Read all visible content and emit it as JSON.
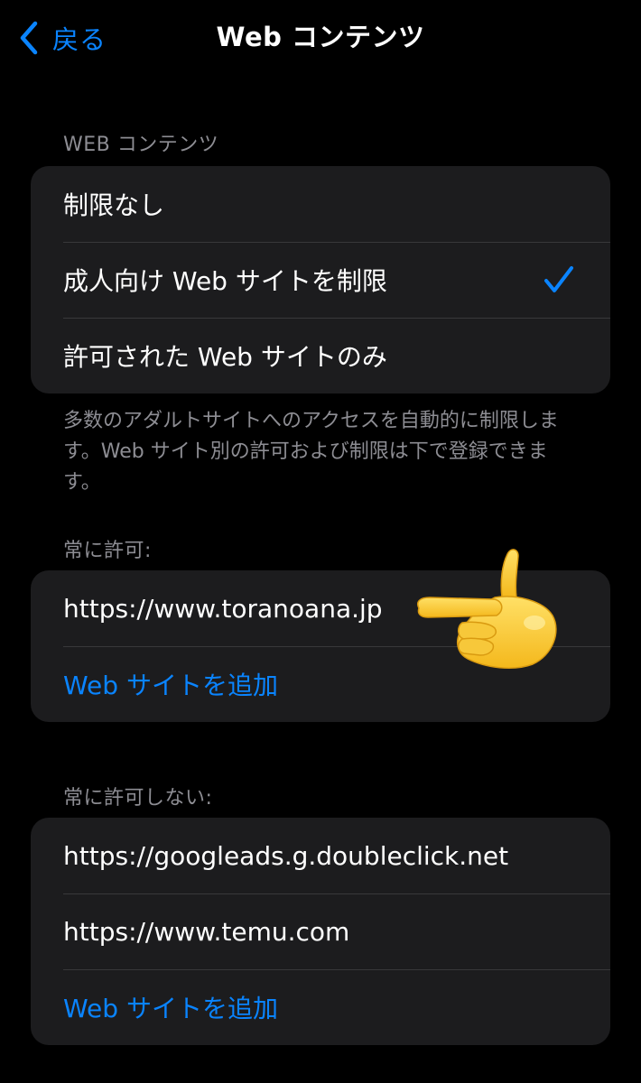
{
  "navbar": {
    "back_label": "戻る",
    "title": "Web コンテンツ",
    "back_icon": "chevron-left-icon"
  },
  "web_content": {
    "header": "WEB コンテンツ",
    "options": [
      {
        "label": "制限なし",
        "selected": false
      },
      {
        "label": "成人向け Web サイトを制限",
        "selected": true
      },
      {
        "label": "許可された Web サイトのみ",
        "selected": false
      }
    ],
    "footer": "多数のアダルトサイトへのアクセスを自動的に制限します。Web サイト別の許可および制限は下で登録できます。"
  },
  "always_allow": {
    "header": "常に許可:",
    "sites": [
      "https://www.toranoana.jp"
    ],
    "add_label": "Web サイトを追加"
  },
  "never_allow": {
    "header": "常に許可しない:",
    "sites": [
      "https://googleads.g.doubleclick.net",
      "https://www.temu.com"
    ],
    "add_label": "Web サイトを追加"
  },
  "colors": {
    "background": "#000000",
    "group_background": "#1c1c1e",
    "accent": "#0a84ff",
    "secondary_text": "#8d8d93",
    "separator": "#38383a"
  },
  "icons": {
    "checkmark": "checkmark-icon",
    "pointing_hand": "pointing-left-hand-emoji"
  }
}
